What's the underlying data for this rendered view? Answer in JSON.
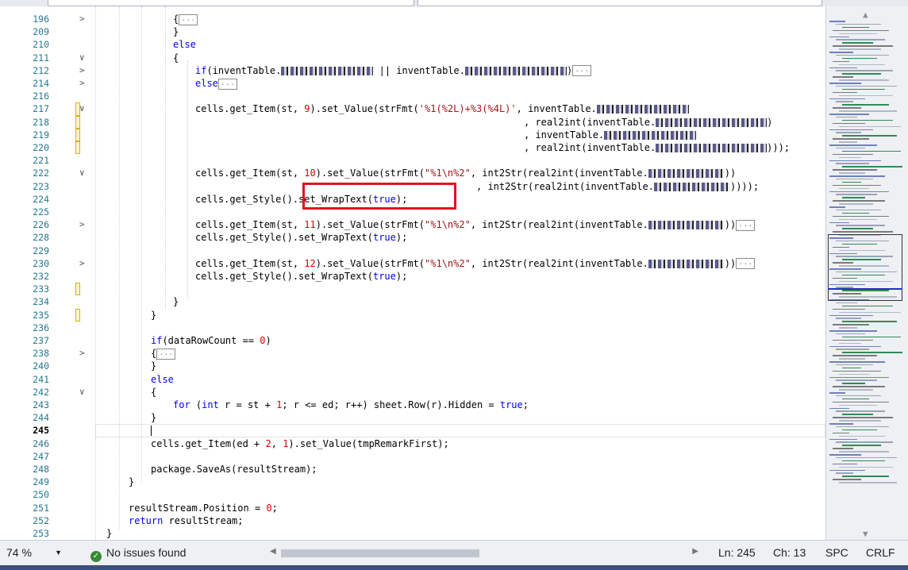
{
  "lines": [
    {
      "num": "196",
      "fold": ">",
      "indent": 218,
      "tokens": [
        {
          "t": "{",
          "c": ""
        },
        {
          "t": "...",
          "c": "coll"
        }
      ]
    },
    {
      "num": "209",
      "indent": 218,
      "tokens": [
        {
          "t": "}",
          "c": ""
        }
      ]
    },
    {
      "num": "210",
      "indent": 218,
      "tokens": [
        {
          "t": "else",
          "c": "kw"
        }
      ]
    },
    {
      "num": "211",
      "fold": "∨",
      "indent": 218,
      "tokens": [
        {
          "t": "{",
          "c": ""
        }
      ]
    },
    {
      "num": "212",
      "fold": ">",
      "indent": 246,
      "tokens": [
        {
          "t": "if",
          "c": "kw"
        },
        {
          "t": "(inventTable.",
          "c": ""
        },
        {
          "t": "",
          "c": "blur",
          "w": 116
        },
        {
          "t": " || inventTable.",
          "c": ""
        },
        {
          "t": "",
          "c": "blur",
          "w": 128
        },
        {
          "t": ")",
          "c": ""
        },
        {
          "t": "...",
          "c": "coll"
        }
      ]
    },
    {
      "num": "214",
      "fold": ">",
      "indent": 246,
      "tokens": [
        {
          "t": "else",
          "c": "kw"
        },
        {
          "t": "...",
          "c": "coll"
        }
      ]
    },
    {
      "num": "216",
      "indent": 246,
      "tokens": []
    },
    {
      "num": "217",
      "fold": "∨",
      "mark": true,
      "indent": 246,
      "tokens": [
        {
          "t": "cells.get_Item(st, ",
          "c": ""
        },
        {
          "t": "9",
          "c": "num"
        },
        {
          "t": ").set_Value(strFmt(",
          "c": ""
        },
        {
          "t": "'%1(%2L)+%3(%4L)'",
          "c": "str"
        },
        {
          "t": ", inventTable.",
          "c": ""
        },
        {
          "t": "",
          "c": "blur",
          "w": 116
        }
      ]
    },
    {
      "num": "218",
      "mark": true,
      "indent": 660,
      "tokens": [
        {
          "t": ", real2int(inventTable.",
          "c": ""
        },
        {
          "t": "",
          "c": "blur",
          "w": 140
        },
        {
          "t": ")",
          "c": ""
        }
      ]
    },
    {
      "num": "219",
      "mark": true,
      "indent": 660,
      "tokens": [
        {
          "t": ", inventTable.",
          "c": ""
        },
        {
          "t": "",
          "c": "blur",
          "w": 116
        }
      ]
    },
    {
      "num": "220",
      "mark": true,
      "indent": 660,
      "tokens": [
        {
          "t": ", real2int(inventTable.",
          "c": ""
        },
        {
          "t": "",
          "c": "blur",
          "w": 140
        },
        {
          "t": ")));",
          "c": ""
        }
      ]
    },
    {
      "num": "221",
      "indent": 246,
      "tokens": []
    },
    {
      "num": "222",
      "fold": "∨",
      "indent": 246,
      "tokens": [
        {
          "t": "cells.get_Item(st, ",
          "c": ""
        },
        {
          "t": "10",
          "c": "num"
        },
        {
          "t": ").set_Value(strFmt(",
          "c": ""
        },
        {
          "t": "\"%1\\n%2\"",
          "c": "str"
        },
        {
          "t": ", int2Str(real2int(inventTable.",
          "c": ""
        },
        {
          "t": "",
          "c": "blur",
          "w": 96
        },
        {
          "t": "))",
          "c": ""
        }
      ]
    },
    {
      "num": "223",
      "indent": 600,
      "tokens": [
        {
          "t": ", int2Str(real2int(inventTable.",
          "c": ""
        },
        {
          "t": "",
          "c": "blur",
          "w": 96
        },
        {
          "t": "))));",
          "c": ""
        }
      ]
    },
    {
      "num": "224",
      "indent": 246,
      "tokens": [
        {
          "t": "cells.get_Style().set_WrapText(",
          "c": ""
        },
        {
          "t": "true",
          "c": "kw"
        },
        {
          "t": ");",
          "c": ""
        }
      ]
    },
    {
      "num": "225",
      "indent": 246,
      "tokens": []
    },
    {
      "num": "226",
      "fold": ">",
      "indent": 246,
      "tokens": [
        {
          "t": "cells.get_Item(st, ",
          "c": ""
        },
        {
          "t": "11",
          "c": "num"
        },
        {
          "t": ").set_Value(strFmt(",
          "c": ""
        },
        {
          "t": "\"%1\\n%2\"",
          "c": "str"
        },
        {
          "t": ", int2Str(real2int(inventTable.",
          "c": ""
        },
        {
          "t": "",
          "c": "blur",
          "w": 96
        },
        {
          "t": "))",
          "c": ""
        },
        {
          "t": "...",
          "c": "coll"
        }
      ]
    },
    {
      "num": "228",
      "indent": 246,
      "tokens": [
        {
          "t": "cells.get_Style().set_WrapText(",
          "c": ""
        },
        {
          "t": "true",
          "c": "kw"
        },
        {
          "t": ");",
          "c": ""
        }
      ]
    },
    {
      "num": "229",
      "indent": 246,
      "tokens": []
    },
    {
      "num": "230",
      "fold": ">",
      "indent": 246,
      "tokens": [
        {
          "t": "cells.get_Item(st, ",
          "c": ""
        },
        {
          "t": "12",
          "c": "num"
        },
        {
          "t": ").set_Value(strFmt(",
          "c": ""
        },
        {
          "t": "\"%1\\n%2\"",
          "c": "str"
        },
        {
          "t": ", int2Str(real2int(inventTable.",
          "c": ""
        },
        {
          "t": "",
          "c": "blur",
          "w": 96
        },
        {
          "t": "))",
          "c": ""
        },
        {
          "t": "...",
          "c": "coll"
        }
      ]
    },
    {
      "num": "232",
      "indent": 246,
      "tokens": [
        {
          "t": "cells.get_Style().set_WrapText(",
          "c": ""
        },
        {
          "t": "true",
          "c": "kw"
        },
        {
          "t": ");",
          "c": ""
        }
      ]
    },
    {
      "num": "233",
      "mark": true,
      "indent": 246,
      "tokens": []
    },
    {
      "num": "234",
      "indent": 218,
      "tokens": [
        {
          "t": "}",
          "c": ""
        }
      ]
    },
    {
      "num": "235",
      "mark": true,
      "indent": 190,
      "tokens": [
        {
          "t": "}",
          "c": ""
        }
      ]
    },
    {
      "num": "236",
      "indent": 190,
      "tokens": []
    },
    {
      "num": "237",
      "indent": 190,
      "tokens": [
        {
          "t": "if",
          "c": "kw"
        },
        {
          "t": "(dataRowCount == ",
          "c": ""
        },
        {
          "t": "0",
          "c": "num"
        },
        {
          "t": ")",
          "c": ""
        }
      ]
    },
    {
      "num": "238",
      "fold": ">",
      "indent": 190,
      "tokens": [
        {
          "t": "{",
          "c": ""
        },
        {
          "t": "...",
          "c": "coll"
        }
      ]
    },
    {
      "num": "240",
      "indent": 190,
      "tokens": [
        {
          "t": "}",
          "c": ""
        }
      ]
    },
    {
      "num": "241",
      "indent": 190,
      "tokens": [
        {
          "t": "else",
          "c": "kw"
        }
      ]
    },
    {
      "num": "242",
      "fold": "∨",
      "indent": 190,
      "tokens": [
        {
          "t": "{",
          "c": ""
        }
      ]
    },
    {
      "num": "243",
      "indent": 218,
      "tokens": [
        {
          "t": "for",
          "c": "kw"
        },
        {
          "t": " (",
          "c": ""
        },
        {
          "t": "int",
          "c": "kw"
        },
        {
          "t": " r = st + ",
          "c": ""
        },
        {
          "t": "1",
          "c": "num"
        },
        {
          "t": "; r <= ed; r++) sheet.Row(r).Hidden = ",
          "c": ""
        },
        {
          "t": "true",
          "c": "kw"
        },
        {
          "t": ";",
          "c": ""
        }
      ]
    },
    {
      "num": "244",
      "indent": 190,
      "tokens": [
        {
          "t": "}",
          "c": ""
        }
      ]
    },
    {
      "num": "245",
      "current": true,
      "indent": 190,
      "tokens": []
    },
    {
      "num": "246",
      "indent": 190,
      "tokens": [
        {
          "t": "cells.get_Item(ed + ",
          "c": ""
        },
        {
          "t": "2",
          "c": "num"
        },
        {
          "t": ", ",
          "c": ""
        },
        {
          "t": "1",
          "c": "num"
        },
        {
          "t": ").set_Value(tmpRemarkFirst);",
          "c": ""
        }
      ]
    },
    {
      "num": "247",
      "indent": 190,
      "tokens": []
    },
    {
      "num": "248",
      "indent": 190,
      "tokens": [
        {
          "t": "package.SaveAs(resultStream);",
          "c": ""
        }
      ]
    },
    {
      "num": "249",
      "indent": 162,
      "tokens": [
        {
          "t": "}",
          "c": ""
        }
      ]
    },
    {
      "num": "250",
      "indent": 162,
      "tokens": []
    },
    {
      "num": "251",
      "indent": 162,
      "tokens": [
        {
          "t": "resultStream.Position = ",
          "c": ""
        },
        {
          "t": "0",
          "c": "num"
        },
        {
          "t": ";",
          "c": ""
        }
      ]
    },
    {
      "num": "252",
      "indent": 162,
      "tokens": [
        {
          "t": "return",
          "c": "kw"
        },
        {
          "t": " resultStream;",
          "c": ""
        }
      ]
    },
    {
      "num": "253",
      "indent": 134,
      "tokens": [
        {
          "t": "}",
          "c": ""
        }
      ]
    }
  ],
  "status": {
    "zoom": "74 %",
    "issues": "No issues found",
    "line": "Ln: 245",
    "col": "Ch: 13",
    "spacing": "SPC",
    "eol": "CRLF"
  },
  "colors": {
    "keyword": "#0000ff",
    "string": "#a31515",
    "number": "#e00000",
    "line_number": "#237893",
    "highlight_box": "#e0141c"
  },
  "icons": {
    "ok": "check-circle-icon",
    "scroll_up": "chevron-up-icon",
    "scroll_down": "chevron-down-icon",
    "scroll_left": "chevron-left-icon",
    "scroll_right": "chevron-right-icon"
  }
}
